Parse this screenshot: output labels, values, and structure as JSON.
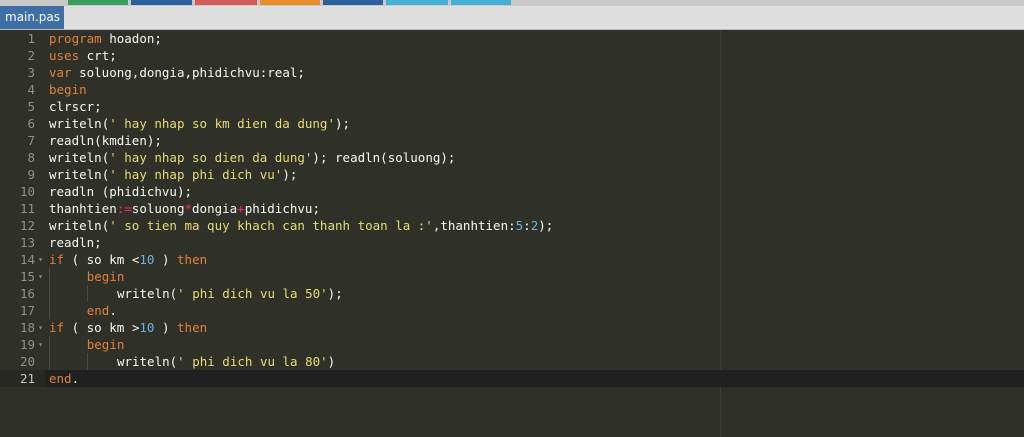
{
  "top_strip_colors": [
    "#3a9d5d",
    "#2c5f9e",
    "#d45b5b",
    "#e88f2a",
    "#2c5f9e",
    "#45b0d3",
    "#45b0d3"
  ],
  "tab": {
    "label": "main.pas"
  },
  "colors": {
    "editor_bg": "#2f3129",
    "keyword": "#e0803a",
    "string": "#e6db74",
    "number": "#6fb0e0",
    "plain": "#f8f8f2"
  },
  "editor": {
    "active_line": 21,
    "folded_lines": [
      14,
      15,
      18,
      19
    ],
    "lines": [
      {
        "n": "1",
        "t": "program hoadon;"
      },
      {
        "n": "2",
        "t": "uses crt;"
      },
      {
        "n": "3",
        "t": "var soluong,dongia,phidichvu:real;"
      },
      {
        "n": "4",
        "t": "begin"
      },
      {
        "n": "5",
        "t": "clrscr;"
      },
      {
        "n": "6",
        "t": "writeln(' hay nhap so km dien da dung');"
      },
      {
        "n": "7",
        "t": "readln(kmdien);"
      },
      {
        "n": "8",
        "t": "writeln(' hay nhap so dien da dung'); readln(soluong);"
      },
      {
        "n": "9",
        "t": "writeln(' hay nhap phi dich vu');"
      },
      {
        "n": "10",
        "t": "readln (phidichvu);"
      },
      {
        "n": "11",
        "t": "thanhtien:=soluong*dongia+phidichvu;"
      },
      {
        "n": "12",
        "t": "writeln(' so tien ma quy khach can thanh toan la :',thanhtien:5:2);"
      },
      {
        "n": "13",
        "t": "readln;"
      },
      {
        "n": "14",
        "t": "if ( so km <10 ) then"
      },
      {
        "n": "15",
        "t": "     begin"
      },
      {
        "n": "16",
        "t": "         writeln(' phi dich vu la 50');"
      },
      {
        "n": "17",
        "t": "     end."
      },
      {
        "n": "18",
        "t": "if ( so km >10 ) then"
      },
      {
        "n": "19",
        "t": "     begin"
      },
      {
        "n": "20",
        "t": "         writeln(' phi dich vu la 80')"
      },
      {
        "n": "21",
        "t": "end."
      }
    ]
  }
}
